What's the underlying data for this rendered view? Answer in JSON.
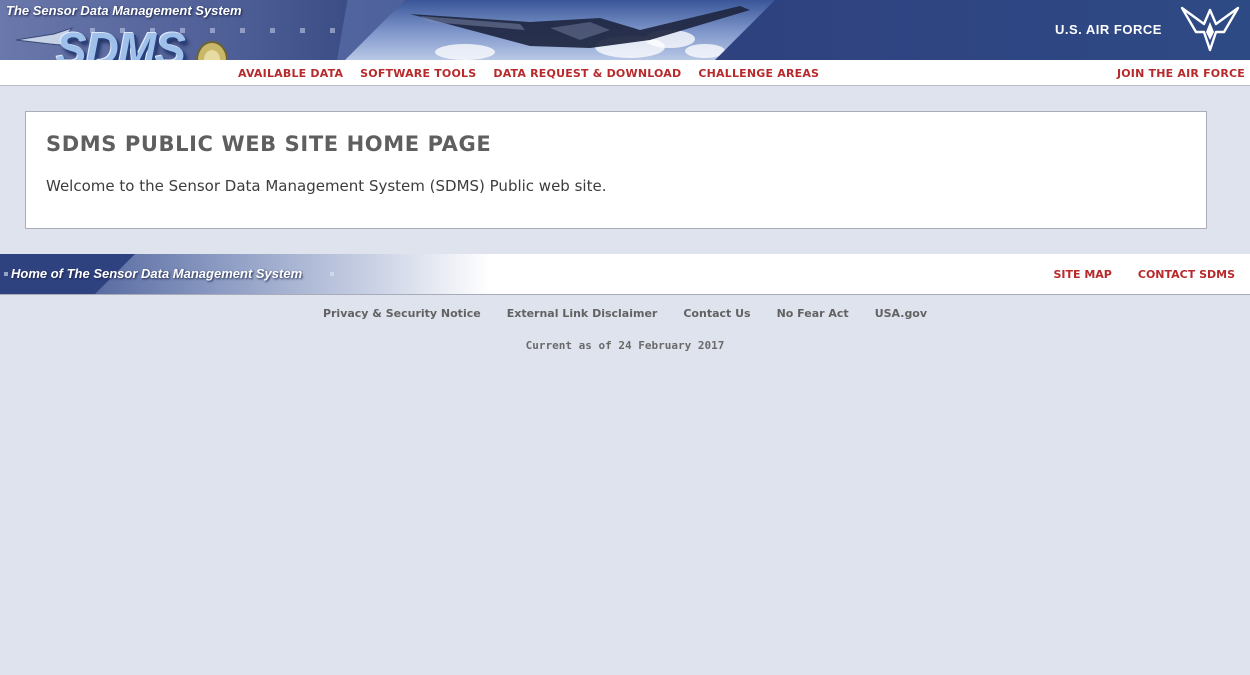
{
  "header": {
    "site_title": "The Sensor Data Management System",
    "logo_text": "SDMS",
    "airforce_text": "U.S. AIR FORCE"
  },
  "nav": {
    "items": [
      {
        "label": "AVAILABLE DATA"
      },
      {
        "label": "SOFTWARE TOOLS"
      },
      {
        "label": "DATA REQUEST & DOWNLOAD"
      },
      {
        "label": "CHALLENGE AREAS"
      }
    ],
    "join_label": "JOIN THE AIR FORCE"
  },
  "main": {
    "heading": "SDMS PUBLIC WEB SITE HOME PAGE",
    "welcome": "Welcome to the Sensor Data Management System (SDMS) Public web site."
  },
  "footer": {
    "home_label": "Home of The Sensor Data Management System",
    "site_map": "SITE MAP",
    "contact": "CONTACT SDMS",
    "links": [
      {
        "label": "Privacy & Security Notice"
      },
      {
        "label": "External Link Disclaimer"
      },
      {
        "label": "Contact Us"
      },
      {
        "label": "No Fear Act"
      },
      {
        "label": "USA.gov"
      }
    ],
    "current_as_of": "Current as of 24 February 2017"
  },
  "colors": {
    "link_red": "#b7292b",
    "banner_blue": "#2f4280",
    "page_bg": "#dfe3ee"
  }
}
